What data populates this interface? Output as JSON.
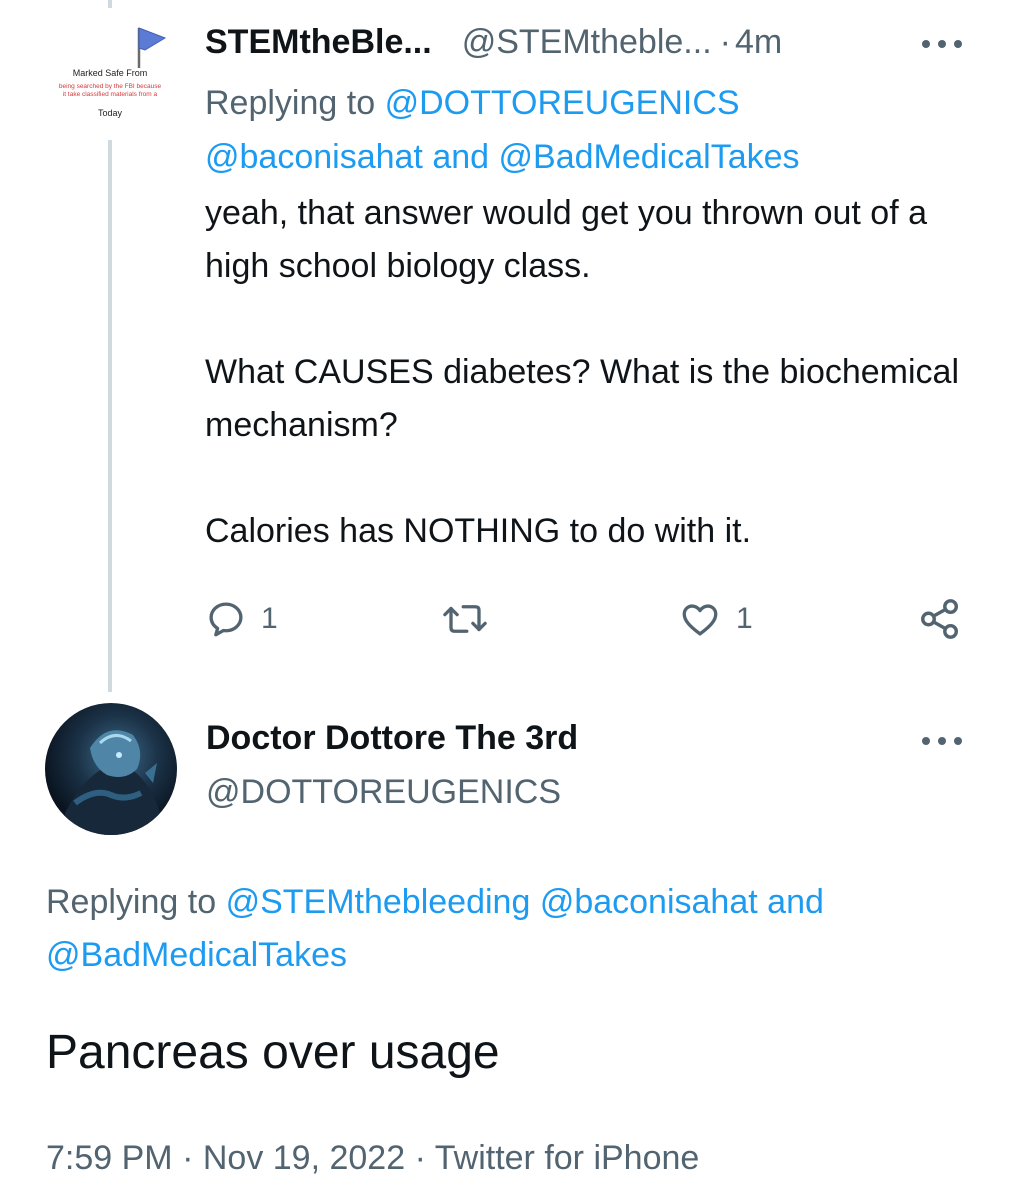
{
  "reply_tweet": {
    "avatar_sticker": {
      "title": "Marked Safe From",
      "subtitle_line1": "being searched by the FBI because",
      "subtitle_line2": "it take classified materials from a",
      "footer": "Today"
    },
    "author_name": "STEMtheBle...",
    "author_handle": "@STEMtheble...",
    "separator": "·",
    "time_ago": "4m",
    "replying_to_label": "Replying to",
    "replying_to_user1": "@DOTTOREUGENICS",
    "replying_to_user2": "@baconisahat",
    "replying_to_and": "and",
    "replying_to_user3": "@BadMedicalTakes",
    "body_paragraphs": [
      "yeah, that answer would get you thrown out of a high school biology class.",
      "What CAUSES diabetes? What is the biochemical mechanism?",
      "Calories has NOTHING to do with it."
    ],
    "actions": {
      "reply_count": "1",
      "retweet_count": "",
      "like_count": "1"
    },
    "icons": [
      "reply-icon",
      "retweet-icon",
      "like-icon",
      "share-icon",
      "more-icon"
    ]
  },
  "main_tweet": {
    "author_name": "Doctor Dottore The 3rd",
    "author_handle": "@DOTTOREUGENICS",
    "replying_to_label": "Replying to",
    "replying_to_user1": "@STEMthebleeding",
    "replying_to_user2": "@baconisahat",
    "replying_to_and": "and",
    "replying_to_user3": "@BadMedicalTakes",
    "body": "Pancreas over usage",
    "time": "7:59 PM",
    "separator": "·",
    "date": "Nov 19, 2022",
    "source": "Twitter for iPhone"
  },
  "colors": {
    "text_primary": "#0f1419",
    "text_secondary": "#536471",
    "link": "#1d9bf0",
    "thread_line": "#cfd9de",
    "flag_blue": "#5b7bd5"
  }
}
